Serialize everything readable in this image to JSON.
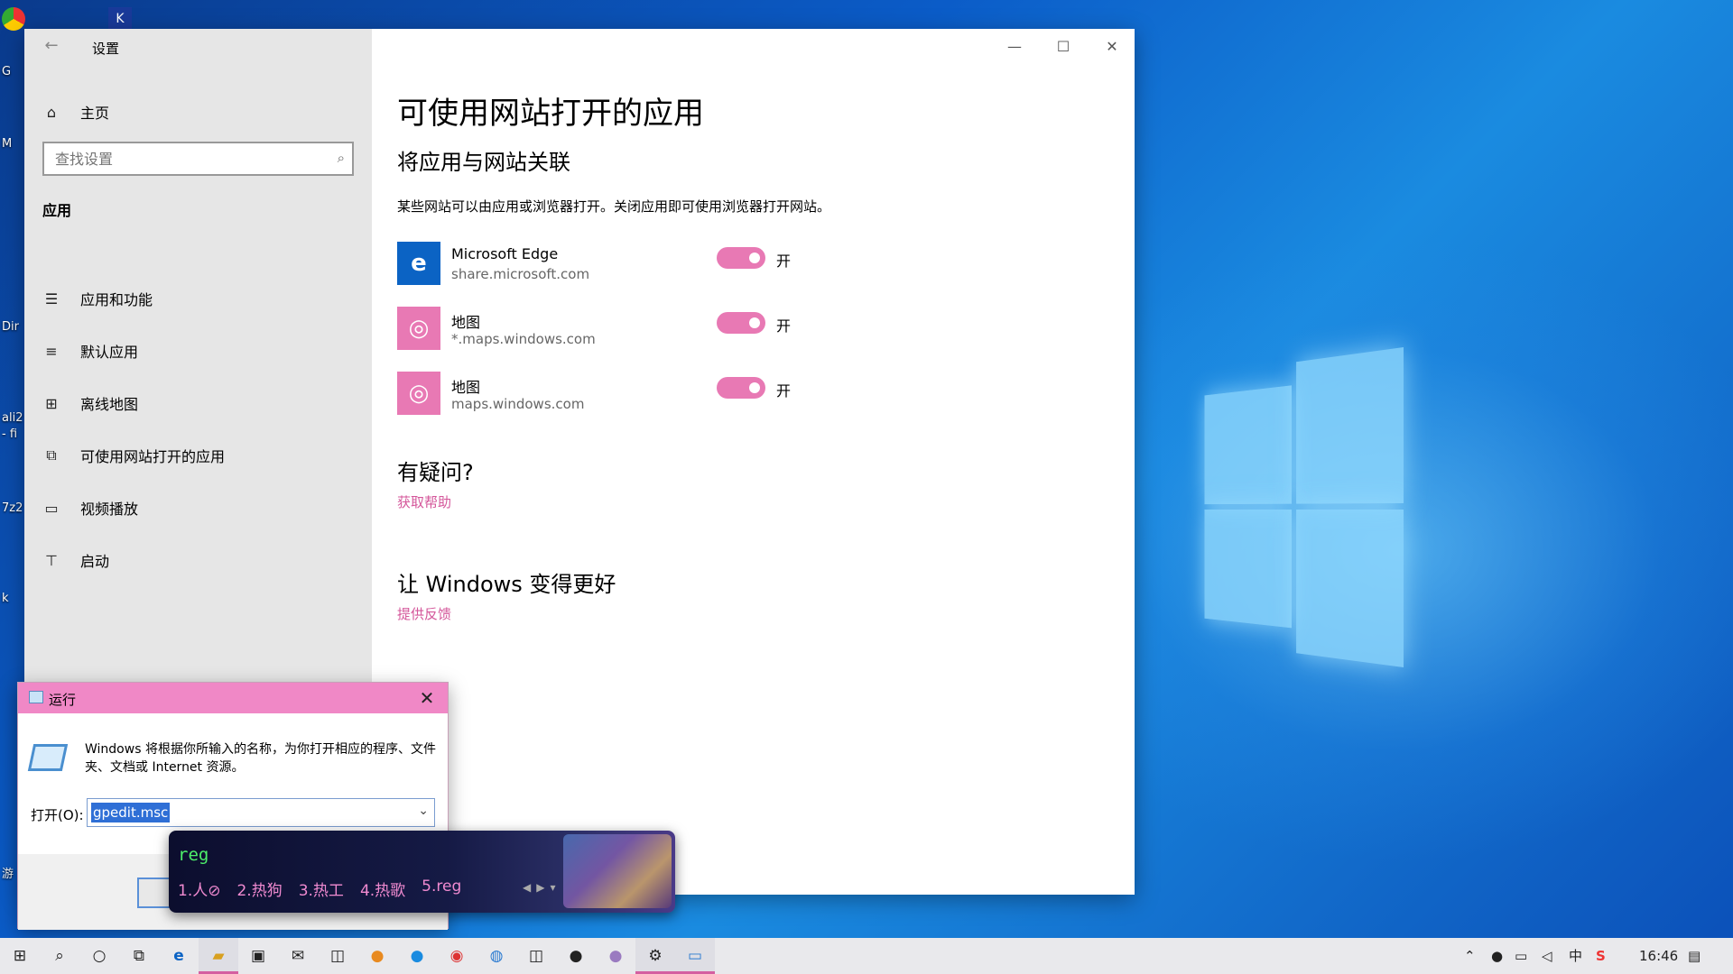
{
  "desktop": {
    "icon_labels": [
      "G",
      "M",
      "Dir",
      "ali2",
      "- fi",
      "7z2",
      "k",
      "游"
    ]
  },
  "settings": {
    "app_title": "设置",
    "home_label": "主页",
    "search_placeholder": "查找设置",
    "section_label": "应用",
    "nav": [
      {
        "label": "应用和功能",
        "icon": "apps-features-icon"
      },
      {
        "label": "默认应用",
        "icon": "default-apps-icon"
      },
      {
        "label": "离线地图",
        "icon": "offline-maps-icon"
      },
      {
        "label": "可使用网站打开的应用",
        "icon": "apps-for-websites-icon"
      },
      {
        "label": "视频播放",
        "icon": "video-playback-icon"
      },
      {
        "label": "启动",
        "icon": "startup-icon"
      }
    ],
    "page_title": "可使用网站打开的应用",
    "subtitle": "将应用与网站关联",
    "description": "某些网站可以由应用或浏览器打开。关闭应用即可使用浏览器打开网站。",
    "apps": [
      {
        "name": "Microsoft Edge",
        "url": "share.microsoft.com",
        "state": "开",
        "on": true,
        "icon": "edge-icon",
        "icon_color": "#0b63c4"
      },
      {
        "name": "地图",
        "url": "*.maps.windows.com",
        "state": "开",
        "on": true,
        "icon": "maps-icon",
        "icon_color": "#e879b4"
      },
      {
        "name": "地图",
        "url": "maps.windows.com",
        "state": "开",
        "on": true,
        "icon": "maps-icon",
        "icon_color": "#e879b4"
      }
    ],
    "question_heading": "有疑问?",
    "get_help_link": "获取帮助",
    "improve_heading": "让 Windows 变得更好",
    "feedback_link": "提供反馈"
  },
  "run_dialog": {
    "title": "运行",
    "message": "Windows 将根据你所输入的名称，为你打开相应的程序、文件夹、文档或 Internet 资源。",
    "open_label": "打开(O):",
    "open_value": "gpedit.msc"
  },
  "ime": {
    "input": "reg",
    "candidates": [
      "1.人⊘",
      "2.热狗",
      "3.热工",
      "4.热歌",
      "5.reg"
    ]
  },
  "taskbar": {
    "time": "16:46",
    "ime_lang": "中"
  },
  "colors": {
    "accent": "#e879b4",
    "link": "#d4569a",
    "run_titlebar": "#f088c6"
  }
}
